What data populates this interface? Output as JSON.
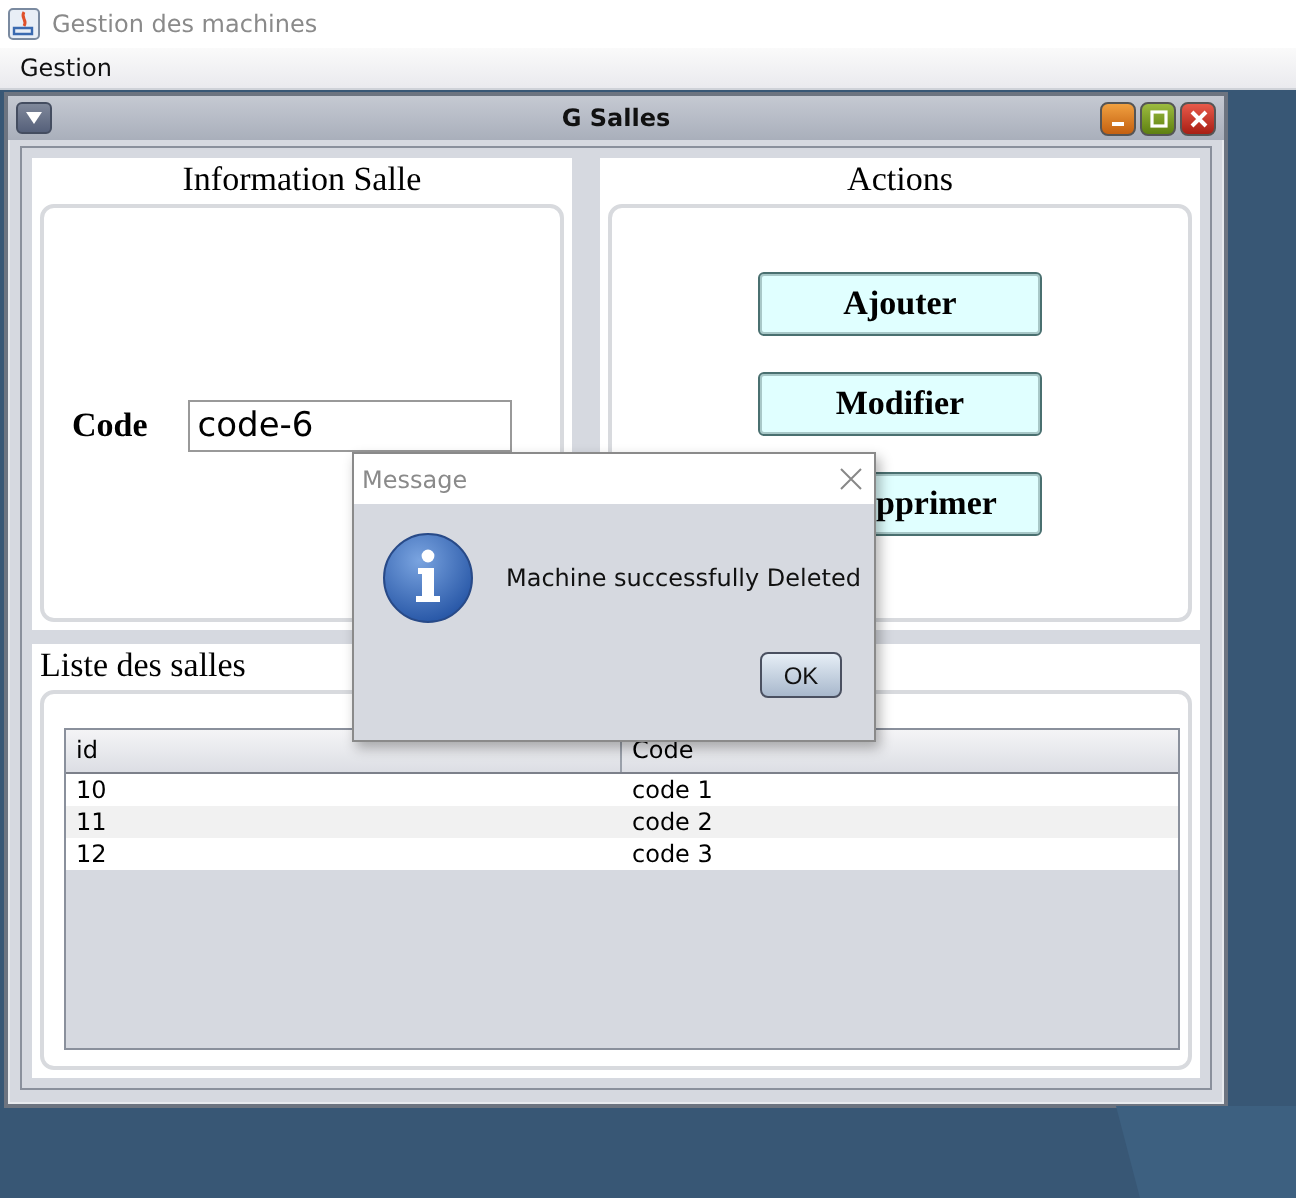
{
  "window": {
    "title": "Gestion des machines"
  },
  "menu": [
    "Gestion"
  ],
  "frame": {
    "title": "G Salles"
  },
  "info_panel": {
    "title": "Information Salle",
    "code_label": "Code",
    "code_value": "code-6"
  },
  "actions_panel": {
    "title": "Actions",
    "buttons": [
      "Ajouter",
      "Modifier",
      "pprimer"
    ]
  },
  "list_panel": {
    "title": "Liste des salles",
    "columns": [
      "id",
      "Code"
    ],
    "rows": [
      [
        "10",
        "code 1"
      ],
      [
        "11",
        "code 2"
      ],
      [
        "12",
        "code 3"
      ]
    ]
  },
  "dialog": {
    "title": "Message",
    "message": "Machine successfully Deleted",
    "button": "OK"
  }
}
